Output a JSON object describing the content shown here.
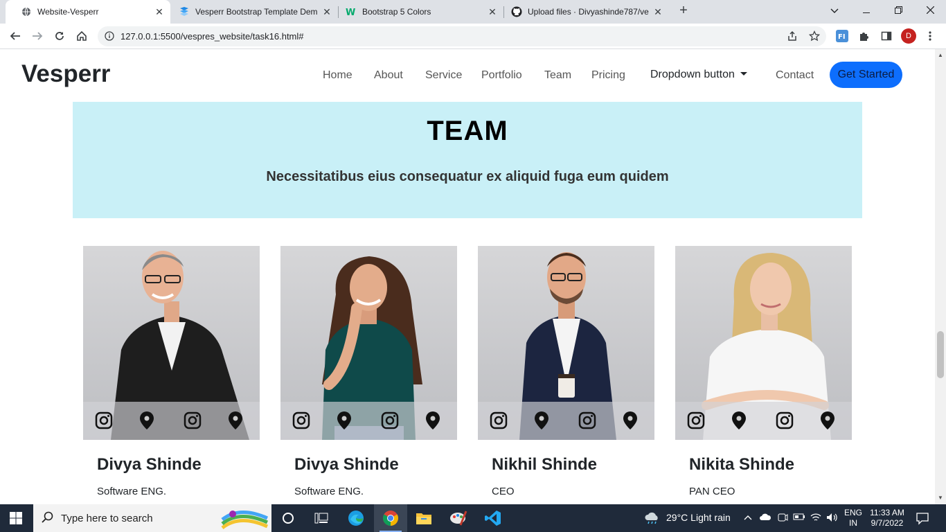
{
  "browser": {
    "tabs": [
      {
        "title": "Website-Vesperr",
        "active": true
      },
      {
        "title": "Vesperr Bootstrap Template Dem",
        "active": false
      },
      {
        "title": "Bootstrap 5 Colors",
        "active": false
      },
      {
        "title": "Upload files · Divyashinde787/ve",
        "active": false
      }
    ],
    "url": "127.0.0.1:5500/vespres_website/task16.html#",
    "profile_initial": "D"
  },
  "site": {
    "brand": "Vesperr",
    "nav": [
      "Home",
      "About",
      "Service",
      "Portfolio",
      "Team",
      "Pricing"
    ],
    "dropdown_label": "Dropdown button",
    "contact_label": "Contact",
    "cta_label": "Get Started",
    "hero": {
      "title": "TEAM",
      "subtitle": "Necessitatibus eius consequatur ex aliquid fuga eum quidem"
    },
    "team": [
      {
        "name": "Divya Shinde",
        "role": "Software ENG."
      },
      {
        "name": "Divya Shinde",
        "role": "Software ENG."
      },
      {
        "name": "Nikhil Shinde",
        "role": "CEO"
      },
      {
        "name": "Nikita Shinde",
        "role": "PAN CEO"
      }
    ],
    "colors": {
      "accent": "#0d6efd",
      "hero_bg": "#c9f0f7"
    }
  },
  "taskbar": {
    "search_placeholder": "Type here to search",
    "weather": "29°C  Light rain",
    "lang_line1": "ENG",
    "lang_line2": "IN",
    "time": "11:33 AM",
    "date": "9/7/2022"
  }
}
